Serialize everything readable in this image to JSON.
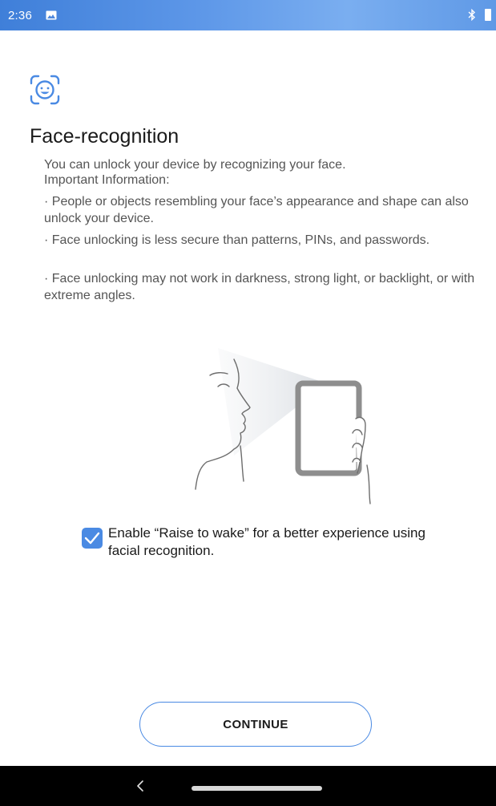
{
  "status_bar": {
    "time": "2:36",
    "icons": [
      "image-icon",
      "bluetooth-icon",
      "battery-icon"
    ]
  },
  "header": {
    "icon": "face-recognition-icon",
    "title": "Face-recognition"
  },
  "description": {
    "intro": "You can unlock your device by recognizing your face.",
    "important_label": "Important Information:",
    "bullets": [
      "· People or objects resembling your face’s appearance and shape can also unlock your device.",
      "· Face unlocking is less secure than patterns,  PINs, and passwords.",
      "· Face unlocking may not work in darkness, strong light, or backlight, or with extreme angles."
    ]
  },
  "illustration": {
    "icon": "face-scan-illustration"
  },
  "raise_to_wake": {
    "checked": true,
    "label": "Enable “Raise to wake” for a better experience using facial recognition."
  },
  "continue_button": {
    "label": "CONTINUE"
  },
  "nav_bar": {
    "icons": [
      "back-icon",
      "home-pill"
    ]
  },
  "colors": {
    "accent": "#4a8ae3",
    "status_bar": "#5d97e8",
    "text_primary": "#1a1a1a",
    "text_secondary": "#555555",
    "nav_bar": "#000000"
  }
}
